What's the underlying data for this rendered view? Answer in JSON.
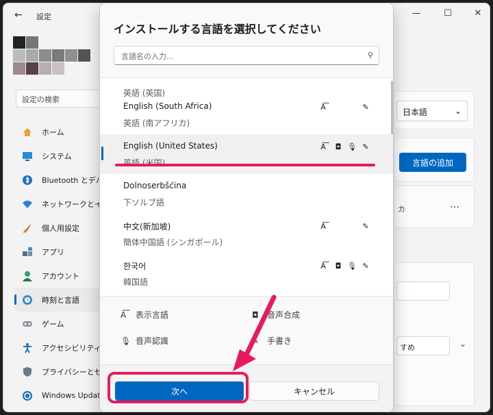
{
  "window": {
    "title": "設定",
    "controls": [
      "—",
      "☐",
      "✕"
    ]
  },
  "sidebar": {
    "search_placeholder": "設定の検索",
    "items": [
      {
        "label": "ホーム",
        "icon": "home-icon"
      },
      {
        "label": "システム",
        "icon": "monitor-icon"
      },
      {
        "label": "Bluetooth とデバイス",
        "icon": "bluetooth-icon"
      },
      {
        "label": "ネットワークとインターネット",
        "icon": "wifi-icon"
      },
      {
        "label": "個人用設定",
        "icon": "brush-icon"
      },
      {
        "label": "アプリ",
        "icon": "apps-icon"
      },
      {
        "label": "アカウント",
        "icon": "account-icon"
      },
      {
        "label": "時刻と言語",
        "icon": "clock-globe-icon",
        "active": true
      },
      {
        "label": "ゲーム",
        "icon": "gamepad-icon"
      },
      {
        "label": "アクセシビリティ",
        "icon": "accessibility-icon"
      },
      {
        "label": "プライバシーとセキュリティ",
        "icon": "shield-icon"
      },
      {
        "label": "Windows Update",
        "icon": "update-icon"
      }
    ]
  },
  "right_panel": {
    "display_language": "日本語",
    "add_language_button": "言語の追加",
    "more_button": "…",
    "partial_text_1": "カ",
    "partial_text_2": "すめ"
  },
  "dialog": {
    "title": "インストールする言語を選択してください",
    "search_placeholder": "言語名の入力...",
    "languages": [
      {
        "name": "",
        "sub": "英語 (英国)",
        "features": []
      },
      {
        "name": "English (South Africa)",
        "sub": "英語 (南アフリカ)",
        "features": [
          "display",
          "handwriting"
        ]
      },
      {
        "name": "English (United States)",
        "sub": "英語 (米国)",
        "features": [
          "display",
          "tts",
          "speech",
          "handwriting"
        ],
        "selected": true
      },
      {
        "name": "Dolnoserbšćina",
        "sub": "下ソルブ語",
        "features": []
      },
      {
        "name": "中文(新加坡)",
        "sub": "簡体中国語 (シンガポール)",
        "features": [
          "display",
          "handwriting"
        ]
      },
      {
        "name": "한국어",
        "sub": "韓国語",
        "features": [
          "display",
          "tts",
          "speech",
          "handwriting"
        ]
      }
    ],
    "legend": {
      "display": "表示言語",
      "tts": "音声合成",
      "speech": "音声認識",
      "handwriting": "手書き"
    },
    "buttons": {
      "next": "次へ",
      "cancel": "キャンセル"
    }
  },
  "colors": {
    "accent": "#0067c0",
    "annotation": "#e8195c"
  }
}
